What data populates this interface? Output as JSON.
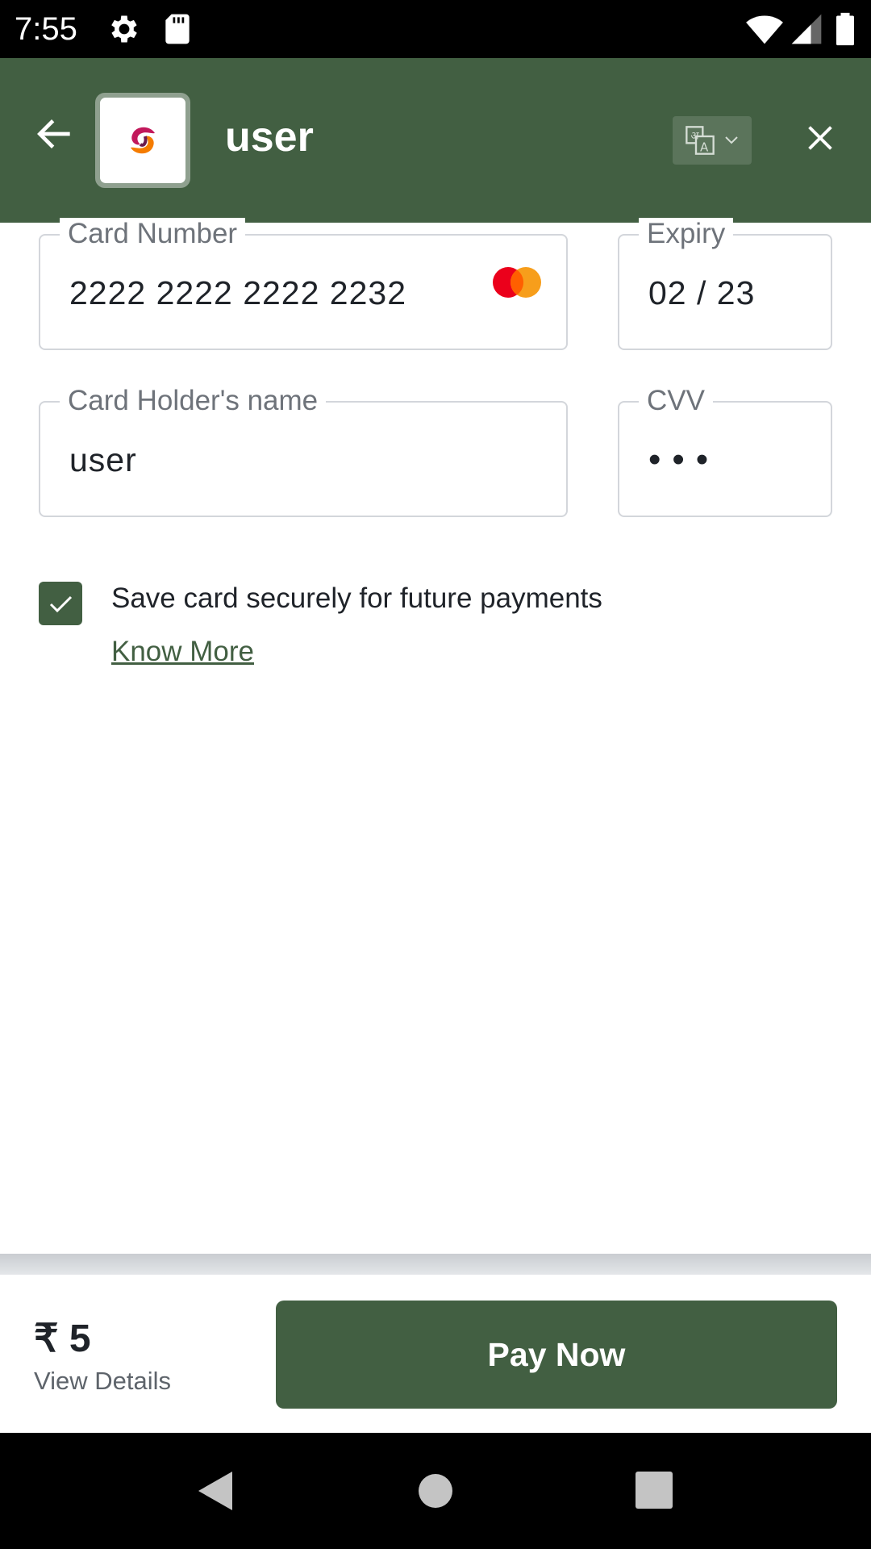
{
  "status_bar": {
    "time": "7:55",
    "left_icons": [
      "settings-icon",
      "sd-card-icon"
    ],
    "right_icons": [
      "wifi-icon",
      "cell-signal-icon",
      "battery-icon"
    ]
  },
  "header": {
    "title": "user",
    "background_color": "#425f42",
    "icons": [
      "back-arrow-icon",
      "merchant-logo",
      "translate-icon",
      "close-icon"
    ]
  },
  "form": {
    "card_number": {
      "label": "Card Number",
      "value": "2222 2222 2222 2232",
      "brand_icon": "mastercard-icon"
    },
    "expiry": {
      "label": "Expiry",
      "value": "02 / 23"
    },
    "card_holder": {
      "label": "Card Holder's name",
      "value": "user"
    },
    "cvv": {
      "label": "CVV",
      "value": "•••"
    },
    "save_card": {
      "checked": true,
      "label": "Save card securely for future payments",
      "link": "Know More"
    }
  },
  "footer": {
    "amount": "₹ 5",
    "view_details": "View Details",
    "pay_button": "Pay Now",
    "accent_color": "#425f42"
  },
  "nav_bar": {
    "icons": [
      "back-triangle-icon",
      "home-circle-icon",
      "recents-square-icon"
    ]
  }
}
